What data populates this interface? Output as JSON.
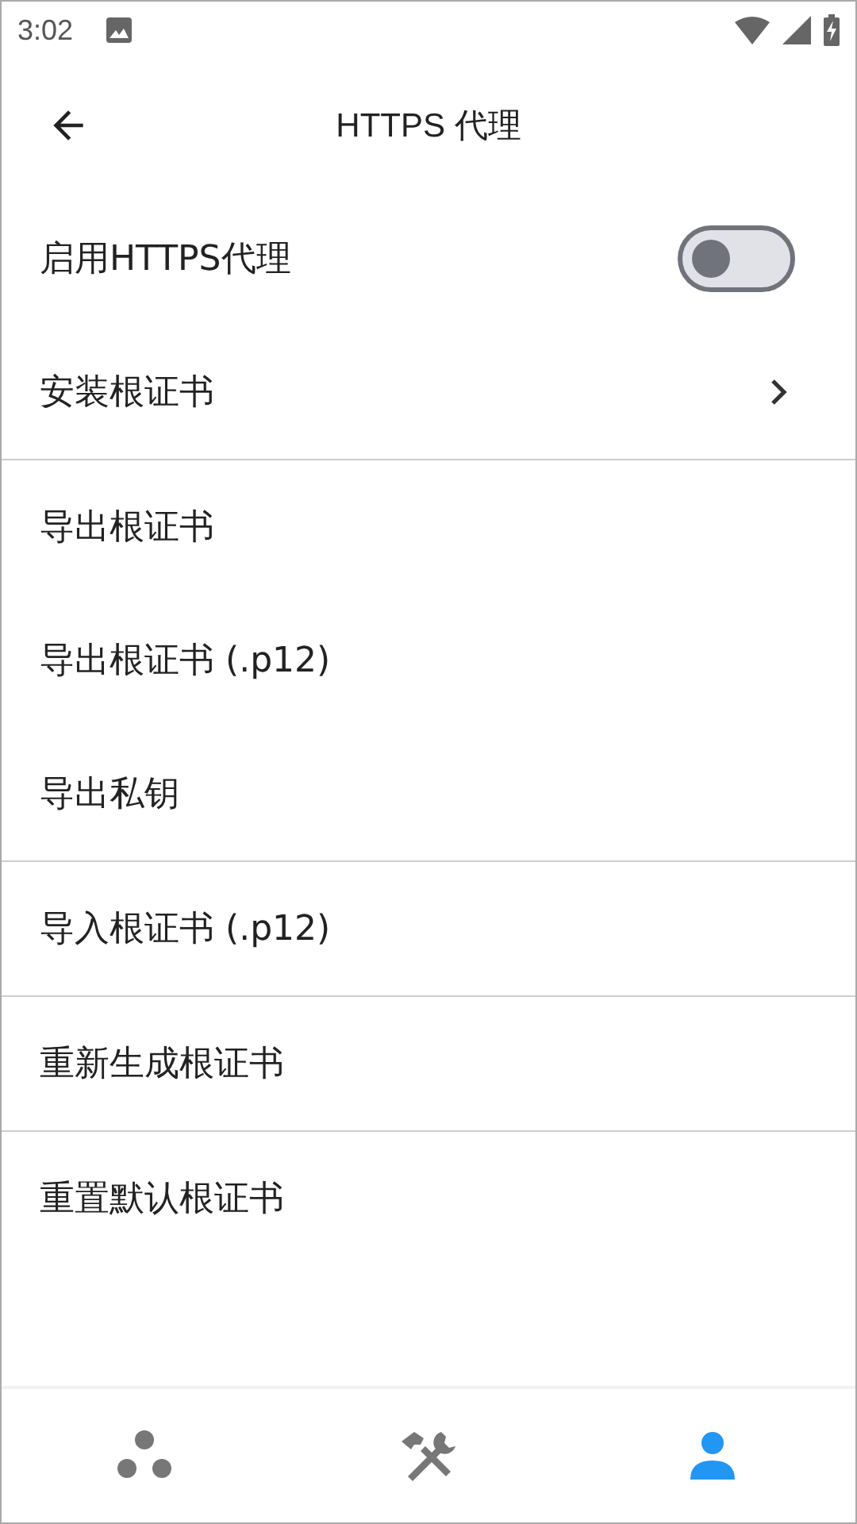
{
  "status_bar": {
    "time": "3:02"
  },
  "app_bar": {
    "title": "HTTPS 代理"
  },
  "sections": [
    {
      "items": [
        {
          "kind": "switch",
          "label": "启用HTTPS代理",
          "on": false
        },
        {
          "kind": "link",
          "label": "安装根证书"
        }
      ]
    },
    {
      "items": [
        {
          "kind": "action",
          "label": "导出根证书"
        },
        {
          "kind": "action",
          "label": "导出根证书 (.p12)"
        },
        {
          "kind": "action",
          "label": "导出私钥"
        }
      ]
    },
    {
      "items": [
        {
          "kind": "action",
          "label": "导入根证书 (.p12)"
        }
      ]
    },
    {
      "items": [
        {
          "kind": "action",
          "label": "重新生成根证书"
        }
      ]
    },
    {
      "items": [
        {
          "kind": "action",
          "label": "重置默认根证书"
        }
      ]
    }
  ],
  "bottom_nav": [
    {
      "kind": "nodes",
      "selected": false
    },
    {
      "kind": "tools",
      "selected": false
    },
    {
      "kind": "person",
      "selected": true
    }
  ]
}
